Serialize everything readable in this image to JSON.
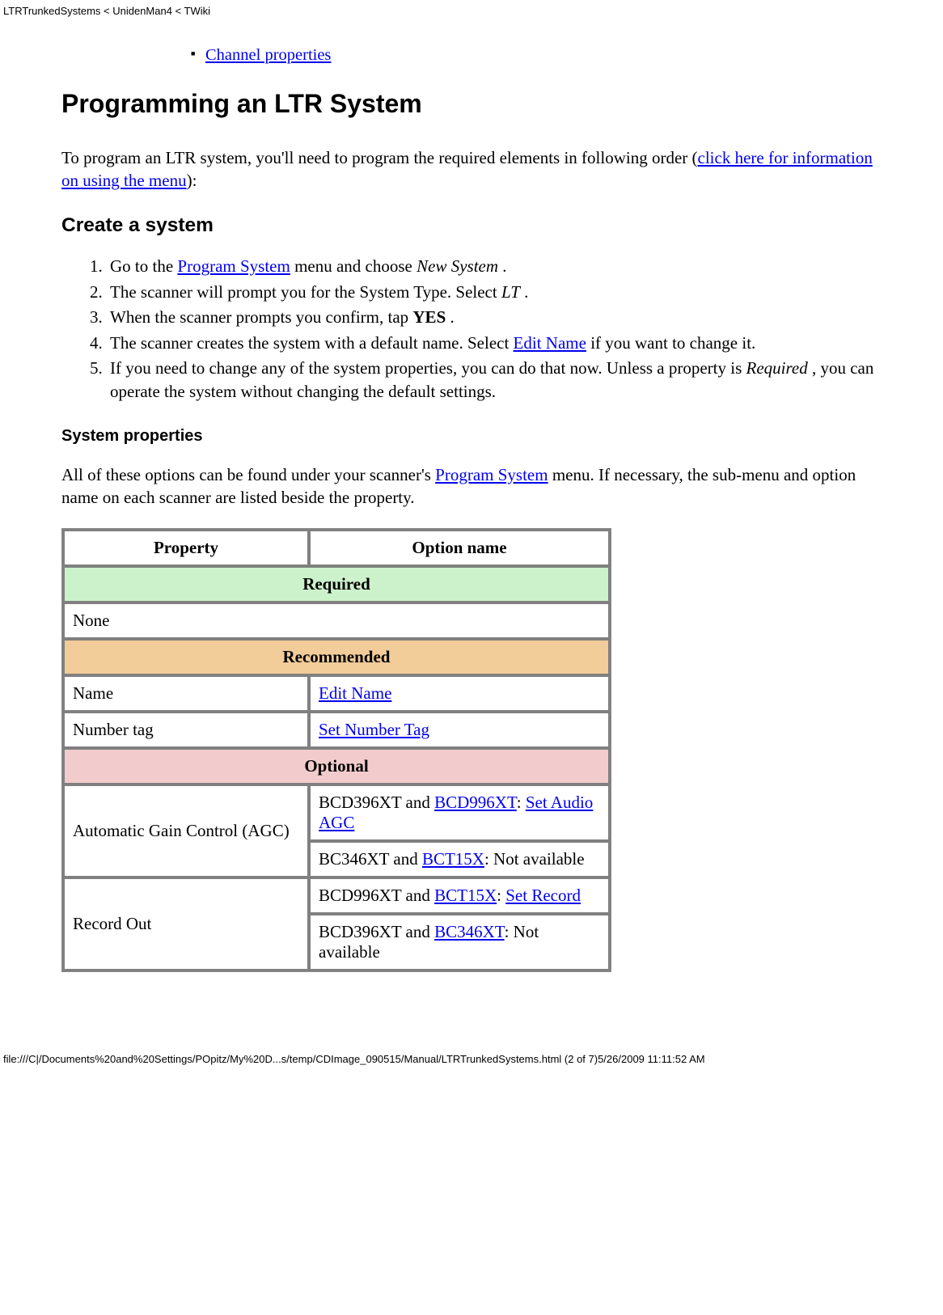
{
  "header_path": "LTRTrunkedSystems < UnidenMan4 < TWiki",
  "toc": {
    "channel_properties": "Channel properties"
  },
  "h1": "Programming an LTR System",
  "intro": {
    "pre": "To program an LTR system, you'll need to program the required elements in following order (",
    "link": "click here for information on using the menu",
    "post": "):"
  },
  "h2_create": "Create a system",
  "steps": {
    "s1_pre": "Go to the ",
    "s1_link": "Program System",
    "s1_post": " menu and choose ",
    "s1_italic": "New System",
    "s1_end": " .",
    "s2_pre": "The scanner will prompt you for the System Type. Select ",
    "s2_italic": "LT",
    "s2_end": " .",
    "s3_pre": "When the scanner prompts you confirm, tap ",
    "s3_bold": "YES",
    "s3_end": " .",
    "s4_pre": "The scanner creates the system with a default name. Select ",
    "s4_link": "Edit Name",
    "s4_post": " if you want to change it.",
    "s5_pre": "If you need to change any of the system properties, you can do that now. Unless a property is ",
    "s5_italic": "Required",
    "s5_post": " , you can operate the system without changing the default settings."
  },
  "h3_sysprops": "System properties",
  "sysprops_intro": {
    "pre": "All of these options can be found under your scanner's ",
    "link": "Program System",
    "post": " menu. If necessary, the sub-menu and option name on each scanner are listed beside the property."
  },
  "table": {
    "th_property": "Property",
    "th_option": "Option name",
    "section_required": "Required",
    "none": "None",
    "section_recommended": "Recommended",
    "name_label": "Name",
    "name_link": "Edit Name",
    "numtag_label": "Number tag",
    "numtag_link": "Set Number Tag",
    "section_optional": "Optional",
    "agc_label": "Automatic Gain Control (AGC)",
    "agc_r1_pre": "BCD396XT and ",
    "agc_r1_link1": "BCD996XT",
    "agc_r1_mid": ": ",
    "agc_r1_link2": "Set Audio AGC",
    "agc_r2_pre": "BC346XT and ",
    "agc_r2_link": "BCT15X",
    "agc_r2_post": ": Not available",
    "rec_label": "Record Out",
    "rec_r1_pre": "BCD996XT and ",
    "rec_r1_link1": "BCT15X",
    "rec_r1_mid": ": ",
    "rec_r1_link2": "Set Record",
    "rec_r2_pre": "BCD396XT and ",
    "rec_r2_link": "BC346XT",
    "rec_r2_post": ": Not available"
  },
  "footer_path": "file:///C|/Documents%20and%20Settings/POpitz/My%20D...s/temp/CDImage_090515/Manual/LTRTrunkedSystems.html (2 of 7)5/26/2009 11:11:52 AM"
}
